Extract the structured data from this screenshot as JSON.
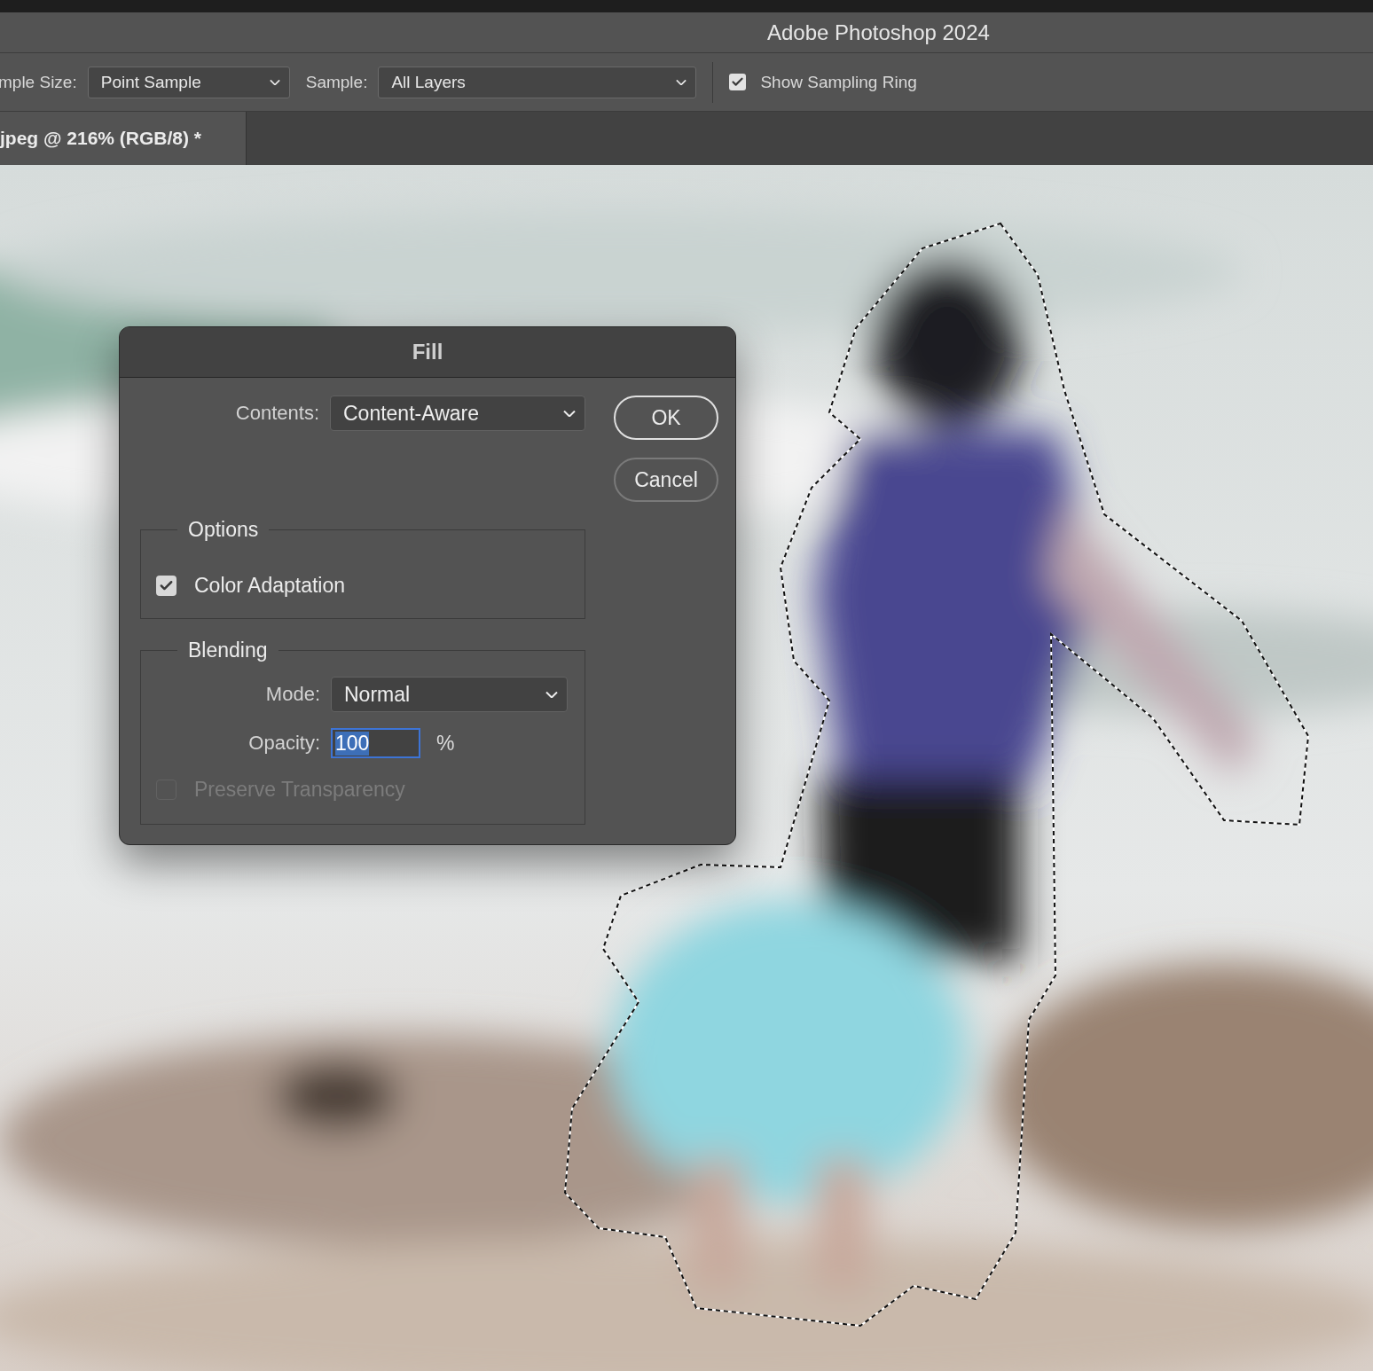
{
  "window": {
    "title": "Adobe Photoshop 2024"
  },
  "options_bar": {
    "sample_size": {
      "label": "mple Size:",
      "value": "Point Sample"
    },
    "sample": {
      "label": "Sample:",
      "value": "All Layers"
    },
    "show_sampling_ring": {
      "label": "Show Sampling Ring",
      "checked": true
    }
  },
  "document_tab": {
    "title": "jpeg @ 216% (RGB/8) *",
    "selected": true
  },
  "dialog": {
    "title": "Fill",
    "contents": {
      "label": "Contents:",
      "value": "Content-Aware"
    },
    "buttons": [
      {
        "label": "OK",
        "default": true
      },
      {
        "label": "Cancel",
        "default": false
      }
    ],
    "options": {
      "title": "Options",
      "color_adaptation": {
        "label": "Color Adaptation",
        "checked": true
      }
    },
    "blending": {
      "title": "Blending",
      "mode": {
        "label": "Mode:",
        "value": "Normal"
      },
      "opacity": {
        "label": "Opacity:",
        "value": "100",
        "unit": "%",
        "selected": true
      },
      "preserve_transparency": {
        "label": "Preserve Transparency",
        "checked": false,
        "disabled": true
      }
    }
  }
}
